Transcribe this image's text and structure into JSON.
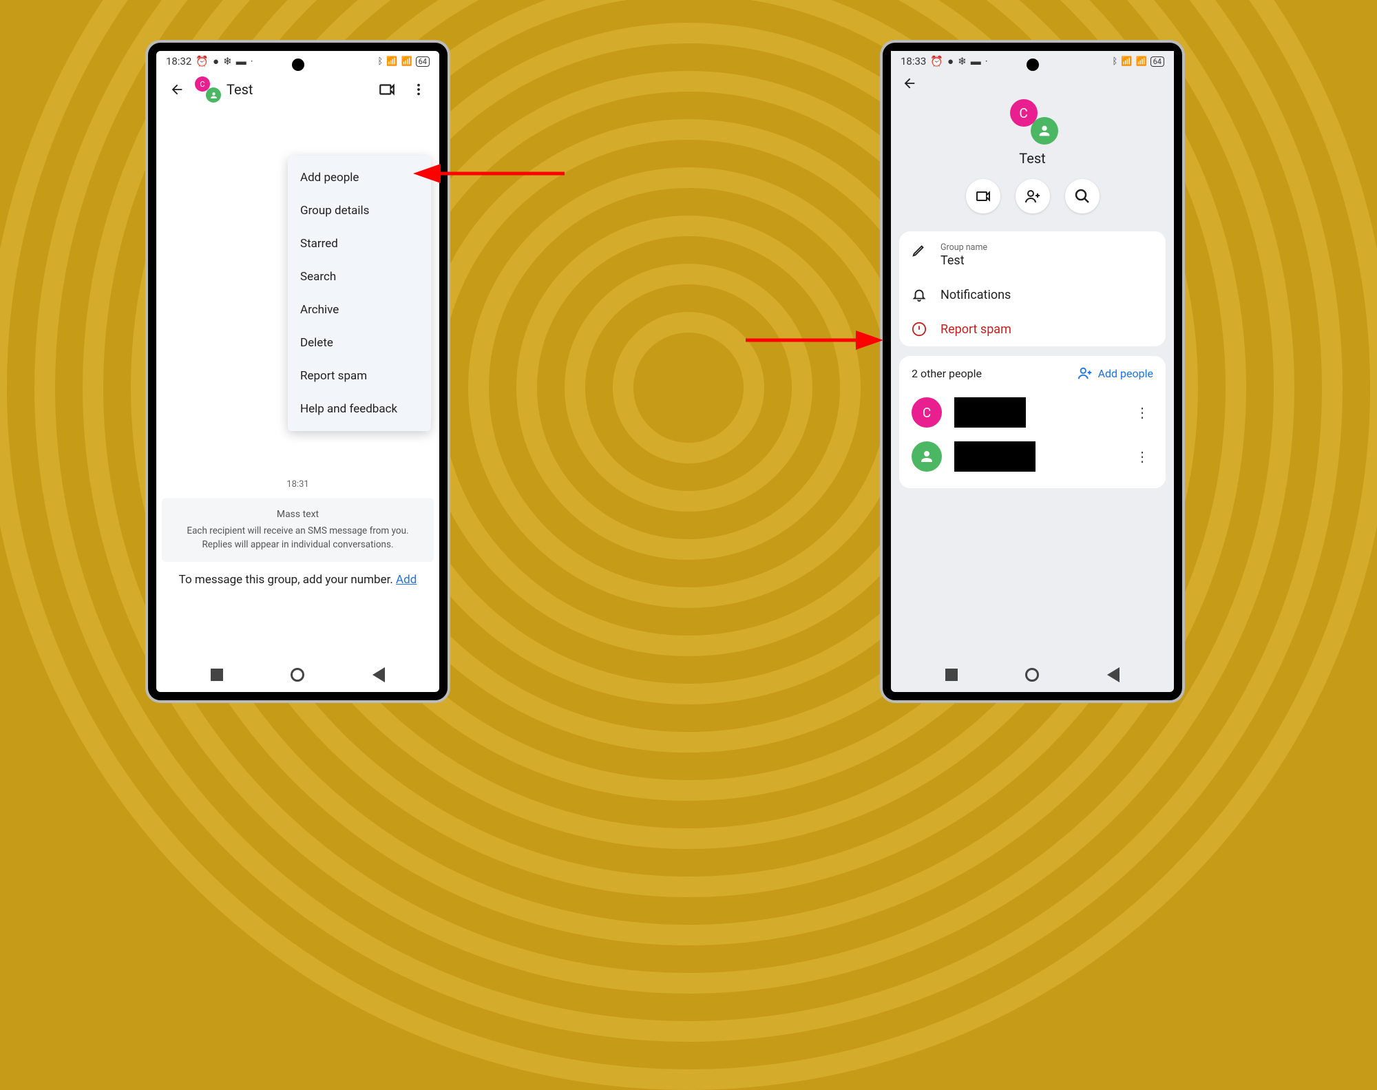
{
  "left": {
    "status_time": "18:32",
    "battery": "64",
    "chat_title": "Test",
    "menu": {
      "add_people": "Add people",
      "group_details": "Group details",
      "starred": "Starred",
      "search": "Search",
      "archive": "Archive",
      "delete": "Delete",
      "report_spam": "Report spam",
      "help": "Help and feedback"
    },
    "timestamp": "18:31",
    "info_title": "Mass text",
    "info_line1": "Each recipient will receive an SMS message from you.",
    "info_line2": "Replies will appear in individual conversations.",
    "cta_text": "To message this group, add your number. ",
    "cta_link": "Add"
  },
  "right": {
    "status_time": "18:33",
    "battery": "64",
    "group_title": "Test",
    "group_name_label": "Group name",
    "group_name_value": "Test",
    "notifications": "Notifications",
    "report_spam": "Report spam",
    "people_count": "2 other people",
    "add_people": "Add people",
    "avatar_initial": "C"
  }
}
